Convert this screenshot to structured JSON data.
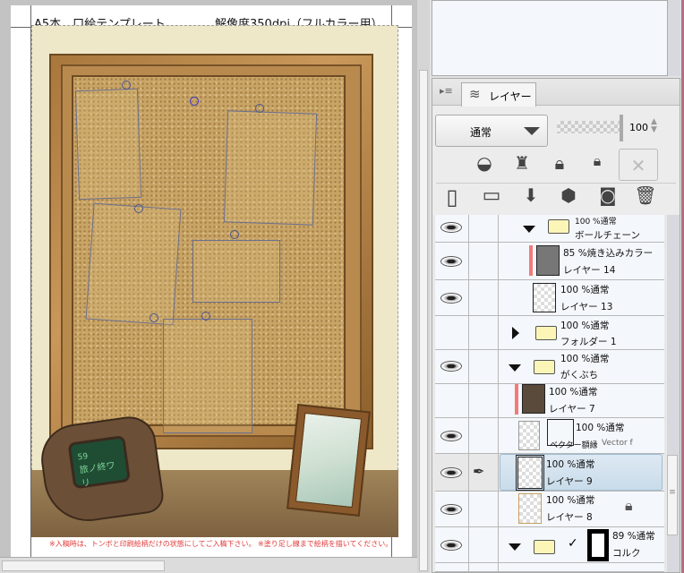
{
  "canvas": {
    "header_left": "A5本　口絵テンプレート",
    "header_right": "解像度350dpi（フルカラー用）",
    "footer_note": "※入稿時は、トンボと印刷絵柄だけの状態にしてご入稿下さい。 ※塗り足し線まで絵柄を描いてください。",
    "pipboy_number": "59",
    "pipboy_text": "旅ノ終ワリ"
  },
  "layer_panel": {
    "tab_label": "レイヤー",
    "blend_mode": "通常",
    "opacity": "100",
    "opacity_percent": 100
  },
  "layers": [
    {
      "name": "ボールチェーン",
      "mode": "100 %通常",
      "type": "folder",
      "expanded": true
    },
    {
      "name": "レイヤー 14",
      "mode": "85 %焼き込みカラー",
      "type": "raster"
    },
    {
      "name": "レイヤー 13",
      "mode": "100 %通常",
      "type": "raster"
    },
    {
      "name": "フォルダー 1",
      "mode": "100 %通常",
      "type": "folder",
      "expanded": false
    },
    {
      "name": "がくぶち",
      "mode": "100 %通常",
      "type": "folder",
      "expanded": true
    },
    {
      "name": "レイヤー 7",
      "mode": "100 %通常",
      "type": "raster"
    },
    {
      "name": "ベクター額縁",
      "extra": "Vector f",
      "mode": "100 %通常",
      "type": "vector"
    },
    {
      "name": "レイヤー 9",
      "mode": "100 %通常",
      "type": "raster",
      "selected": true
    },
    {
      "name": "レイヤー 8",
      "mode": "100 %通常",
      "type": "raster",
      "locked": true
    },
    {
      "name": "コルク",
      "mode": "89 %通常",
      "type": "folder",
      "expanded": true
    }
  ],
  "colors": {
    "selected": "#d4e6f3",
    "clip_bar": "#f47a7a",
    "panel_bg": "#f4f7fb"
  }
}
